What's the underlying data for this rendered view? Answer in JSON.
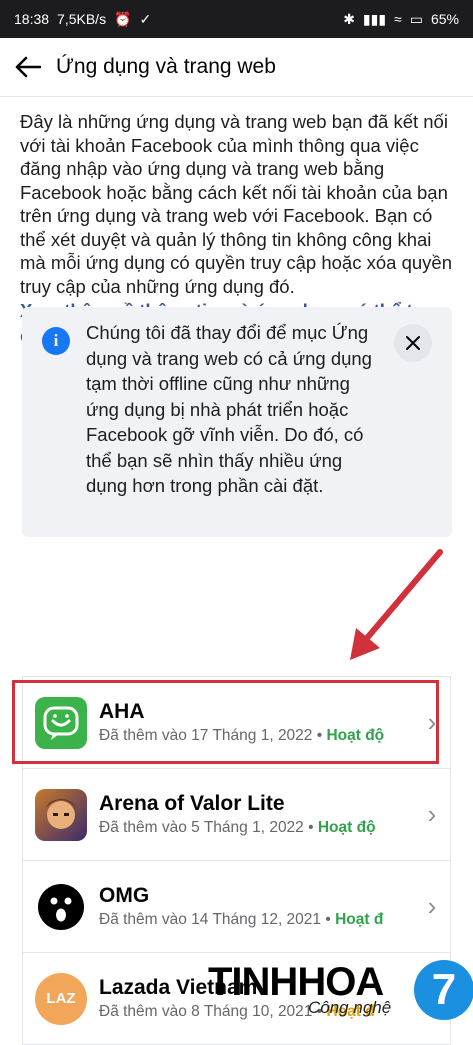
{
  "status_bar": {
    "time": "18:38",
    "speed": "7,5KB/s",
    "battery": "65%"
  },
  "header": {
    "title": "Ứng dụng và trang web"
  },
  "description": "Đây là những ứng dụng và trang web bạn đã kết nối với tài khoản Facebook của mình thông qua việc đăng nhập vào ứng dụng và trang web bằng Facebook hoặc bằng cách kết nối tài khoản của bạn trên ứng dụng và trang web với Facebook. Bạn có thể xét duyệt và quản lý thông tin không công khai mà mỗi ứng dụng có quyền truy cập hoặc xóa quyền truy cập của những ứng dụng đó.",
  "more_link": "Xem thêm về thông tin mà ứng dụng có thể truy cập",
  "notice": {
    "text": "Chúng tôi đã thay đổi để mục Ứng dụng và trang web có cả ứng dụng tạm thời offline cũng như những ứng dụng bị nhà phát triển hoặc Facebook gỡ vĩnh viễn. Do đó, có thể bạn sẽ nhìn thấy nhiều ứng dụng hơn trong phần cài đặt."
  },
  "apps": [
    {
      "name": "AHA",
      "added": "Đã thêm vào 17 Tháng 1, 2022",
      "status": "Hoạt độ"
    },
    {
      "name": "Arena of Valor Lite",
      "added": "Đã thêm vào 5 Tháng 1, 2022",
      "status": "Hoạt độ"
    },
    {
      "name": "OMG",
      "added": "Đã thêm vào 14 Tháng 12, 2021",
      "status": "Hoạt đ"
    },
    {
      "name": "Lazada Vietnam",
      "added": "Đã thêm vào 8 Tháng 10, 2021",
      "status": "Hoạt đ"
    }
  ],
  "watermark": {
    "brand": "TINHHOA",
    "sub": "Công nghệ",
    "logo_char": "7"
  },
  "colors": {
    "link": "#365899",
    "status": "#31a24c",
    "highlight": "#d0313b",
    "info": "#1877f2"
  }
}
